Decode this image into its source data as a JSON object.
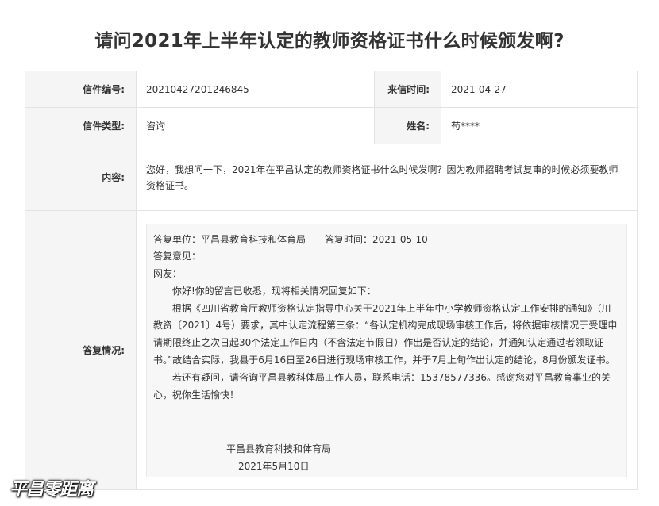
{
  "page": {
    "title": "请问2021年上半年认定的教师资格证书什么时候颁发啊?"
  },
  "letter": {
    "id_label": "信件编号:",
    "id_value": "20210427201246845",
    "date_label": "来信时间:",
    "date_value": "2021-04-27",
    "type_label": "信件类型:",
    "type_value": "咨询",
    "name_label": "姓名:",
    "name_value": "苟****",
    "content_label": "内容:",
    "content_value": "您好，我想问一下，2021年在平昌认定的教师资格证书什么时候发啊？因为教师招聘考试复审的时候必须要教师资格证书。",
    "reply_label": "答复情况:"
  },
  "reply": {
    "header": "答复单位：平昌县教育科技和体育局　　答复时间：2021-05-10",
    "opinion_label": "答复意见：",
    "greeting": "网友：",
    "line1": "你好!你的留言已收悉，现将相关情况回复如下：",
    "line2": "根据《四川省教育厅教师资格认定指导中心关于2021年上半年中小学教师资格认定工作安排的通知》（川教资〔2021〕4号）要求，其中认定流程第三条：“各认定机构完成现场审核工作后，将依据审核情况于受理申请期限终止之次日起30个法定工作日内（不含法定节假日）作出是否认定的结论，并通知认定通过者领取证书。”故结合实际，我县于6月16日至26日进行现场审核工作，并于7月上旬作出认定的结论，8月份颁发证书。",
    "line3": "若还有疑问，请咨询平昌县教科体局工作人员，联系电话：15378577336。感谢您对平昌教育事业的关心，祝你生活愉快！",
    "signature_org": "平昌县教育科技和体育局",
    "signature_date": "2021年5月10日"
  },
  "watermark": {
    "text": "平昌零距离"
  }
}
